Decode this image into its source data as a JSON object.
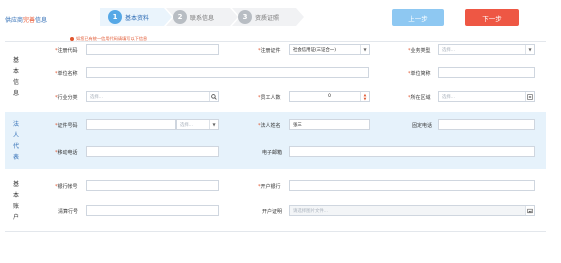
{
  "header": {
    "title_part1": "供应商",
    "title_part2": "完善",
    "title_part3": "信息",
    "steps": [
      {
        "num": "1",
        "label": "基本资料",
        "active": true
      },
      {
        "num": "2",
        "label": "联系信息",
        "active": false
      },
      {
        "num": "3",
        "label": "资质证照",
        "active": false
      }
    ],
    "prev_button": "上一步",
    "next_button": "下一步"
  },
  "hint": "如您已有统一信用代码请填写以下信息",
  "sections": {
    "basic": {
      "label_chars": [
        "基",
        "本",
        "信",
        "息"
      ],
      "fields": {
        "reg_code": {
          "label": "*注册代码",
          "value": ""
        },
        "reg_cert": {
          "label": "*注册证件",
          "value": "社会信用证(三证合一)"
        },
        "biz_type": {
          "label": "*业务类型",
          "placeholder": "选择..."
        },
        "unit_name": {
          "label": "*单位名称",
          "value": ""
        },
        "unit_short": {
          "label": "*单位简称",
          "value": ""
        },
        "industry": {
          "label": "*行业分类",
          "placeholder": "选择..."
        },
        "employees": {
          "label": "*员工人数",
          "value": "0"
        },
        "region": {
          "label": "*所在区域",
          "placeholder": "选择..."
        }
      }
    },
    "legal": {
      "label_chars": [
        "法",
        "人",
        "代",
        "表"
      ],
      "fields": {
        "id_no": {
          "label": "*证件号码",
          "placeholder": "选择..."
        },
        "legal_name": {
          "label": "*法人姓名",
          "value": "张三"
        },
        "fixed_phone": {
          "label": "固定电话",
          "value": ""
        },
        "mobile": {
          "label": "*移动电话",
          "value": ""
        },
        "email": {
          "label": "电子邮箱",
          "value": ""
        }
      }
    },
    "account": {
      "label_chars": [
        "基",
        "本",
        "账",
        "户"
      ],
      "fields": {
        "bank_account": {
          "label": "*银行帐号",
          "value": ""
        },
        "bank_open": {
          "label": "*开户银行",
          "value": ""
        },
        "clearing_no": {
          "label": "清算行号",
          "value": ""
        },
        "open_cert": {
          "label": "开户证明",
          "placeholder": "请选择图片文件..."
        }
      }
    }
  },
  "colors": {
    "brand_blue": "#2f6db5",
    "accent_orange": "#e8542e",
    "step_active": "#56a8e6",
    "step_inactive": "#b8bdc3",
    "prev_btn": "#8ec8f2",
    "next_btn": "#ee5744",
    "legal_bg": "#e6f2fb"
  }
}
